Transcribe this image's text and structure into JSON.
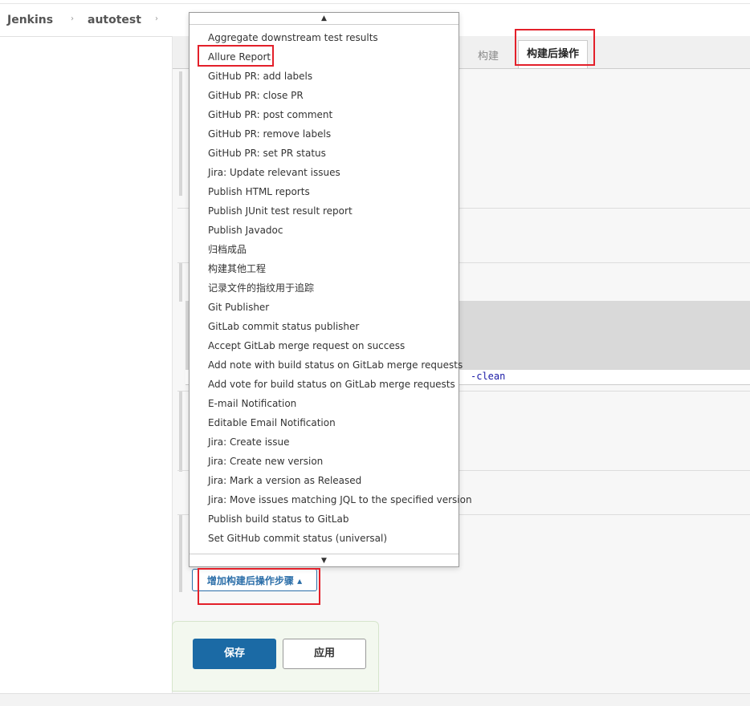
{
  "breadcrumb": {
    "root": "Jenkins",
    "project": "autotest",
    "sep": "›"
  },
  "tabs": {
    "build": "构建",
    "post_build": "构建后操作"
  },
  "code_snippet": "-clean",
  "dropdown": {
    "up_arrow": "▲",
    "down_arrow": "▼",
    "items": [
      "Aggregate downstream test results",
      "Allure Report",
      "GitHub PR: add labels",
      "GitHub PR: close PR",
      "GitHub PR: post comment",
      "GitHub PR: remove labels",
      "GitHub PR: set PR status",
      "Jira: Update relevant issues",
      "Publish HTML reports",
      "Publish JUnit test result report",
      "Publish Javadoc",
      "归档成品",
      "构建其他工程",
      "记录文件的指纹用于追踪",
      "Git Publisher",
      "GitLab commit status publisher",
      "Accept GitLab merge request on success",
      "Add note with build status on GitLab merge requests",
      "Add vote for build status on GitLab merge requests",
      "E-mail Notification",
      "Editable Email Notification",
      "Jira: Create issue",
      "Jira: Create new version",
      "Jira: Mark a version as Released",
      "Jira: Move issues matching JQL to the specified version",
      "Publish build status to GitLab",
      "Set GitHub commit status (universal)"
    ]
  },
  "add_post_step": {
    "label": "增加构建后操作步骤 ▴"
  },
  "actions": {
    "save": "保存",
    "apply": "应用"
  },
  "colors": {
    "highlight": "#e3202a",
    "primary": "#1b6aa5"
  }
}
